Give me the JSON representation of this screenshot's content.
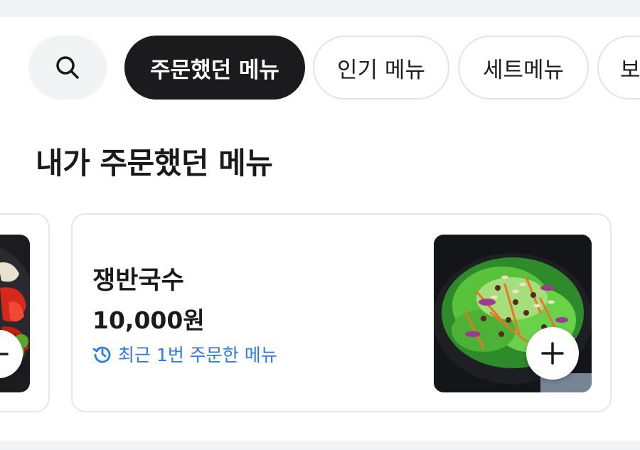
{
  "filters": {
    "search_icon": "search-icon",
    "chips": [
      {
        "label": "주문했던 메뉴",
        "active": true
      },
      {
        "label": "인기 메뉴",
        "active": false
      },
      {
        "label": "세트메뉴",
        "active": false
      },
      {
        "label": "보",
        "active": false
      }
    ]
  },
  "section": {
    "title": "내가 주문했던 메뉴"
  },
  "items": [
    {
      "name": "쟁반국수",
      "price": "10,000원",
      "reorder_note": "최근 1번 주문한 메뉴",
      "history_icon": "clock-history-icon",
      "add_icon": "plus-icon"
    }
  ],
  "colors": {
    "accent_blue": "#2b7be4",
    "active_chip": "#1b1b1d",
    "background": "#f2f3f5"
  }
}
